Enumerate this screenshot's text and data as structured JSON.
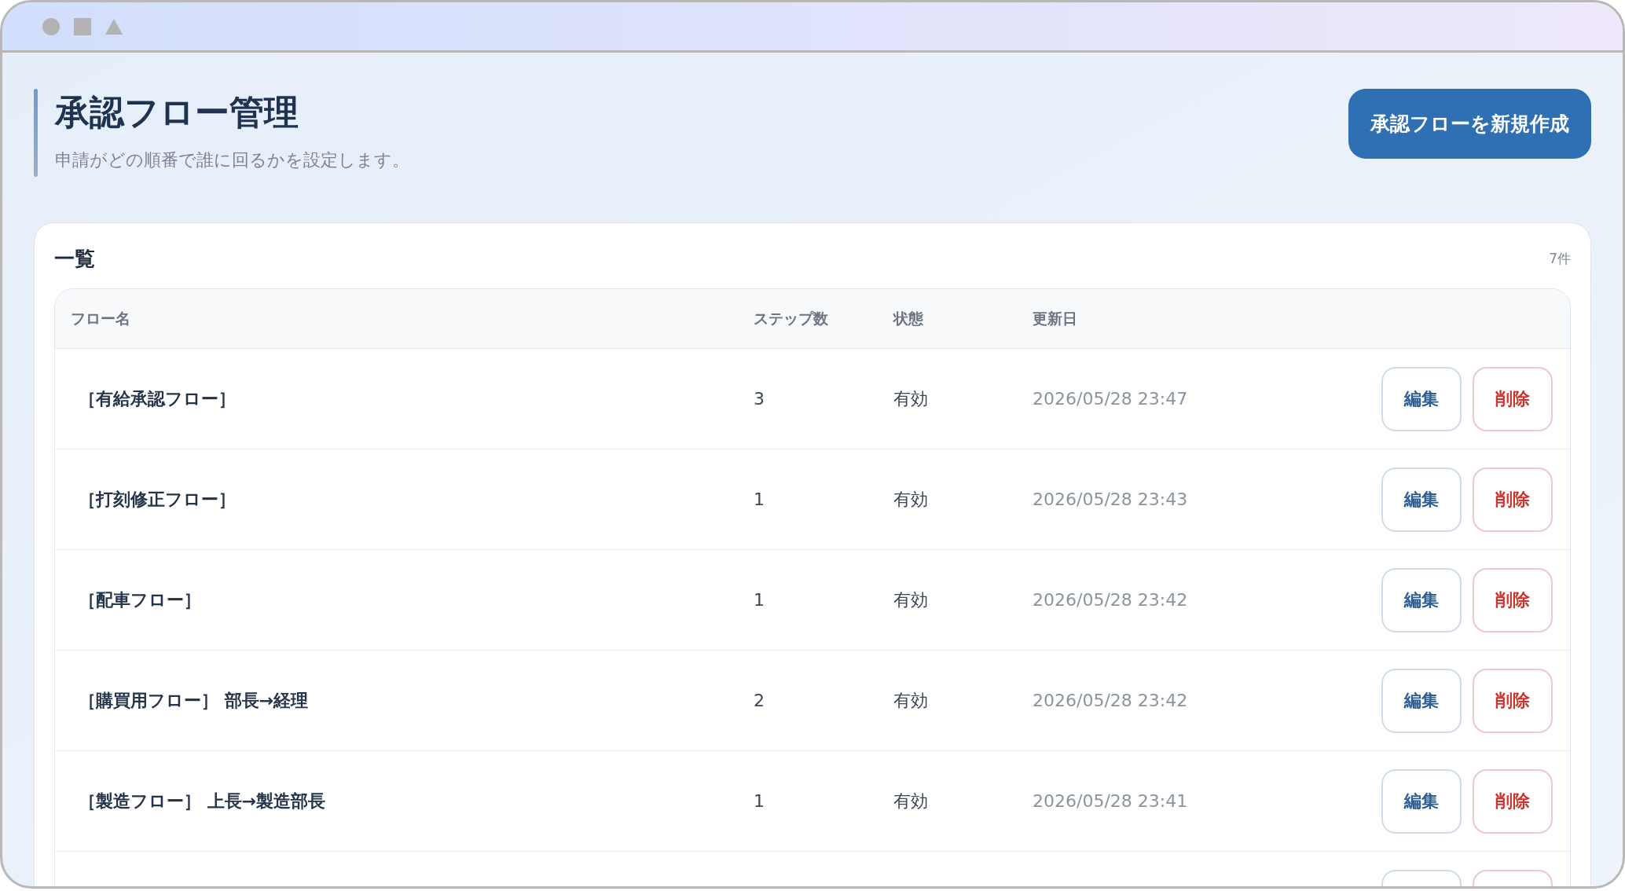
{
  "page": {
    "title": "承認フロー管理",
    "subtitle": "申請がどの順番で誰に回るかを設定します。",
    "create_button": "承認フローを新規作成"
  },
  "list": {
    "heading": "一覧",
    "count": "7件",
    "columns": [
      "フロー名",
      "ステップ数",
      "状態",
      "更新日"
    ],
    "rows": [
      {
        "name": "［有給承認フロー］",
        "steps": "3",
        "status": "有効",
        "updated": "2026/05/28 23:47",
        "edit": "編集",
        "delete": "削除"
      },
      {
        "name": "［打刻修正フロー］",
        "steps": "1",
        "status": "有効",
        "updated": "2026/05/28 23:43",
        "edit": "編集",
        "delete": "削除"
      },
      {
        "name": "［配車フロー］",
        "steps": "1",
        "status": "有効",
        "updated": "2026/05/28 23:42",
        "edit": "編集",
        "delete": "削除"
      },
      {
        "name": "［購買用フロー］ 部長→経理",
        "steps": "2",
        "status": "有効",
        "updated": "2026/05/28 23:42",
        "edit": "編集",
        "delete": "削除"
      },
      {
        "name": "［製造フロー］ 上長→製造部長",
        "steps": "1",
        "status": "有効",
        "updated": "2026/05/28 23:41",
        "edit": "編集",
        "delete": "削除"
      }
    ],
    "more_rows_below": true
  }
}
